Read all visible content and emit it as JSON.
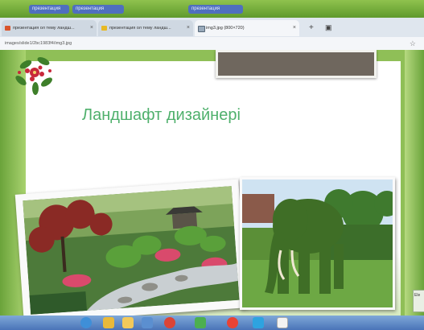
{
  "topbar": {
    "items": [
      "презентация",
      "презентация",
      "презентация"
    ]
  },
  "browser": {
    "tabs": [
      {
        "label": "презентация ол тему ландш..."
      },
      {
        "label": "презентация ол тему ландш..."
      },
      {
        "label": "img3.jpg (800×720)"
      }
    ],
    "new_tab": "+",
    "address": "images/slide1/2bc1983f4/img3.jpg",
    "bookmark_star": "☆"
  },
  "slide": {
    "title": "Ландшафт дизайнері"
  },
  "side_widget": {
    "text": "Ele"
  },
  "taskbar": {
    "icons": [
      "start-orb",
      "ie",
      "explorer",
      "media",
      "chrome",
      "app-a",
      "yandex",
      "skype",
      "paint"
    ]
  },
  "colors": {
    "title": "#4fb06c",
    "grey_box": "#6f675e",
    "page_green": "#8fbf57"
  }
}
